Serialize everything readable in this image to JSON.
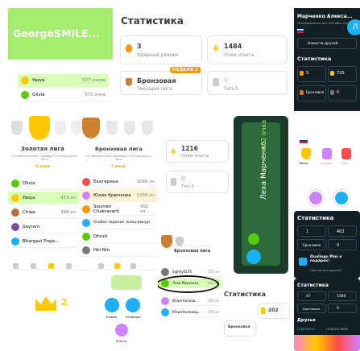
{
  "username_banner": {
    "text": "GeorgeSMILE..."
  },
  "stats": {
    "title": "Статистика",
    "streak_value": "3",
    "streak_label": "Ударный режим",
    "xp_value": "1484",
    "xp_label": "Очки опыта",
    "week_badge": "НЕДЕЛЯ 1",
    "league_value": "Бронзовая",
    "league_label": "Текущая лига",
    "top_value": "0",
    "top_label": "Топ-3"
  },
  "stats_small": {
    "xp_value": "1216",
    "xp_label": "Очки опыта",
    "top_value": "0",
    "top_label": "Топ-3"
  },
  "mini_leaderboard": {
    "rows": [
      {
        "name": "Yasya",
        "points": "577 очков"
      },
      {
        "name": "Olivia",
        "points": "572 очка"
      }
    ]
  },
  "gold_league": {
    "title": "Золотая лига",
    "subtitle": "10 победителей перейдут в следующую лигу",
    "days": "5 дней",
    "rows": [
      {
        "rank": "6",
        "name": "Olivia",
        "points": ""
      },
      {
        "rank": "7",
        "name": "Yasya",
        "points": "473 оч"
      },
      {
        "rank": "8",
        "name": "Chlae",
        "points": "396 оч"
      },
      {
        "rank": "9",
        "name": "bayram",
        "points": ""
      },
      {
        "rank": "10",
        "name": "Bhargavi Praja...",
        "points": ""
      }
    ]
  },
  "bronze_league": {
    "title": "Бронзовая лига",
    "subtitle": "10 победителей перейдут в следующую лигу",
    "days": "7 дней",
    "rows": [
      {
        "name": "Екатерина",
        "points": "3066 оч"
      },
      {
        "name": "Юлия Крючкова",
        "points": "1256 оч"
      },
      {
        "name": "Soumen Chakravarti",
        "points": "991 оч"
      },
      {
        "name": "Особое задание: Блиц-рекурс",
        "points": ""
      },
      {
        "name": "Dhruti",
        "points": ""
      },
      {
        "name": "Hél Nin",
        "points": ""
      }
    ]
  },
  "vertical_card": {
    "name": "Леха Марченко",
    "points": "402 очка"
  },
  "profile_dark": {
    "name": "Марченко Алекса...",
    "joined": "Присоединился(-ась) сентябрь 2021",
    "news_label": "Новости друзей",
    "stats_title": "Статистика",
    "values": [
      "5",
      "729",
      "Бронзовая",
      "0"
    ]
  },
  "bronze_small": {
    "title": "Бронзовая лига",
    "rows": [
      {
        "name": "Sightly6176",
        "points": "725 оч"
      },
      {
        "name": "Леха Марченко",
        "points": "402 оч"
      },
      {
        "name": "Юлия Кислов...",
        "points": "355 оч"
      },
      {
        "name": "Юлия Коломоц...",
        "points": "276 оч"
      }
    ]
  },
  "stats_bottom": {
    "title": "Статистика",
    "xp_value": "202",
    "league_value": "Бронзовая"
  },
  "stats_dark": {
    "title": "Статистика",
    "values": [
      "1",
      "402",
      "Бронзовая",
      "0"
    ]
  },
  "plus_gift": {
    "title": "Duolingo Plus в подарок!",
    "subtitle": "Пригласите друзей"
  },
  "stats_dark_bottom": {
    "title": "Статистика",
    "values": [
      "47",
      "1584",
      "Бронзовая",
      "0"
    ],
    "friends": "Друзья",
    "tabs": [
      "ПОДПИСКИ",
      "ПОДПИСЧИКИ"
    ]
  },
  "crown_tile": {
    "value": "2"
  },
  "mid_icons": {
    "labels": [
      "Все уроки",
      "Ежедн.",
      "Итоги"
    ]
  },
  "side_icons": {
    "labels": [
      "Меню",
      "Вперёд",
      "Ещё"
    ]
  },
  "app_icons": {
    "labels": [
      "Ежедн",
      "Юникорн",
      "В путь"
    ]
  },
  "colors": {
    "green": "#58cc02",
    "light_green": "#d7ffb8",
    "gold": "#ffc800",
    "dark": "#131f24",
    "blue": "#1cb0f6"
  }
}
